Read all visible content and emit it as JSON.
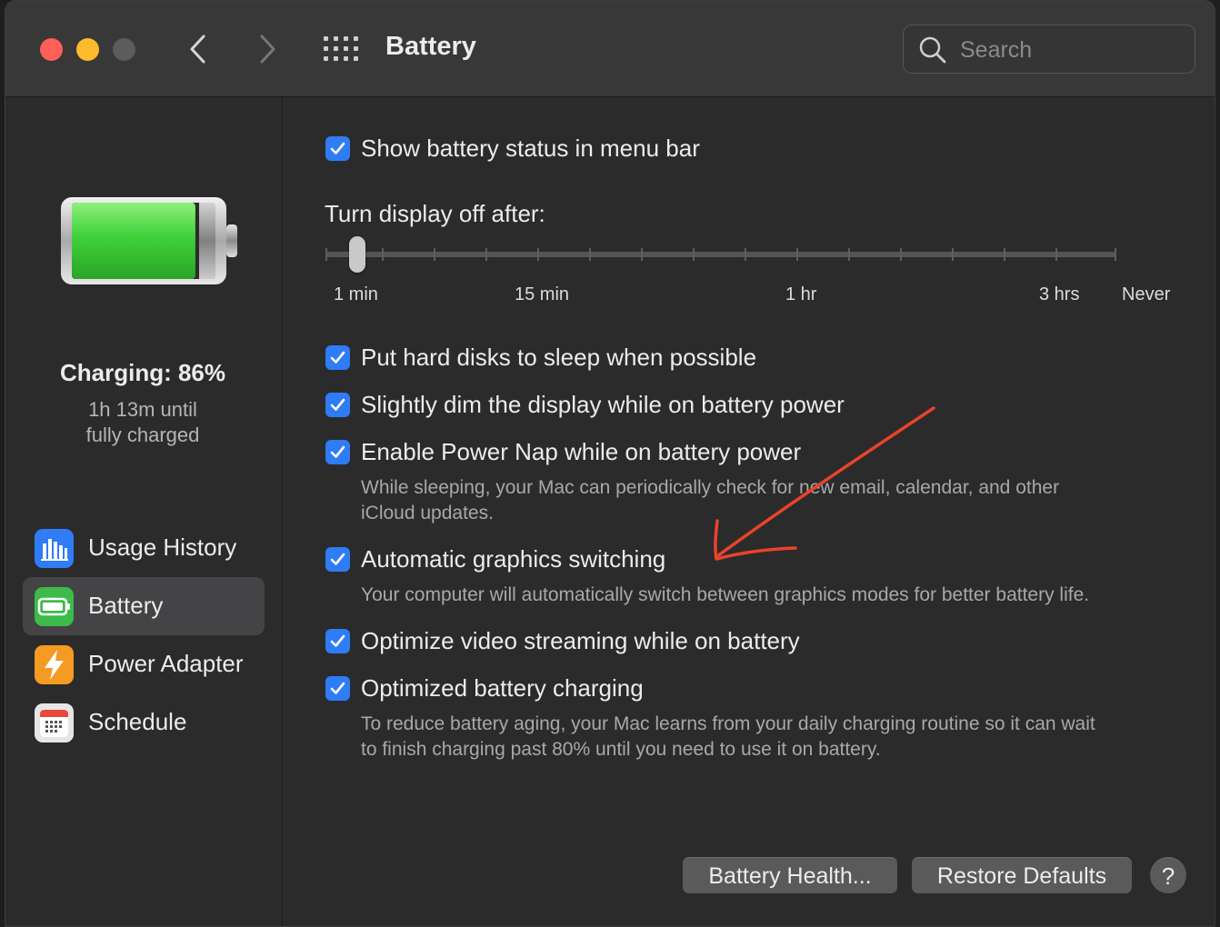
{
  "window": {
    "title": "Battery",
    "search": {
      "placeholder": "Search",
      "value": ""
    }
  },
  "sidebar": {
    "status_title": "Charging: 86%",
    "status_line1": "1h 13m until",
    "status_line2": "fully charged",
    "charge_percent": 86,
    "items": [
      {
        "label": "Usage History",
        "icon": "bar-chart-icon",
        "color": "#2f7cf6",
        "selected": false
      },
      {
        "label": "Battery",
        "icon": "battery-icon",
        "color": "#3dbb4a",
        "selected": true
      },
      {
        "label": "Power Adapter",
        "icon": "lightning-icon",
        "color": "#f59a23",
        "selected": false
      },
      {
        "label": "Schedule",
        "icon": "calendar-icon",
        "color": "#e6e6e6",
        "selected": false
      }
    ]
  },
  "main": {
    "show_status": {
      "label": "Show battery status in menu bar",
      "checked": true
    },
    "display_off": {
      "label": "Turn display off after:",
      "ticks": [
        "1 min",
        "15 min",
        "1 hr",
        "3 hrs",
        "Never"
      ],
      "selected": "1 min"
    },
    "options": [
      {
        "label": "Put hard disks to sleep when possible",
        "checked": true
      },
      {
        "label": "Slightly dim the display while on battery power",
        "checked": true
      },
      {
        "label": "Enable Power Nap while on battery power",
        "checked": true,
        "desc1": "While sleeping, your Mac can periodically check for new email, calendar, and other",
        "desc2": "iCloud updates."
      },
      {
        "label": "Automatic graphics switching",
        "checked": true,
        "desc1": "Your computer will automatically switch between graphics modes for better battery life."
      },
      {
        "label": "Optimize video streaming while on battery",
        "checked": true
      },
      {
        "label": "Optimized battery charging",
        "checked": true,
        "desc1": "To reduce battery aging, your Mac learns from your daily charging routine so it can wait",
        "desc2": "to finish charging past 80% until you need to use it on battery."
      }
    ],
    "buttons": {
      "battery_health": "Battery Health...",
      "restore_defaults": "Restore Defaults",
      "help": "?"
    }
  },
  "colors": {
    "accent": "#2e7cf6",
    "battery_green": "#3fd13a",
    "annotation_arrow": "#e8432c"
  }
}
